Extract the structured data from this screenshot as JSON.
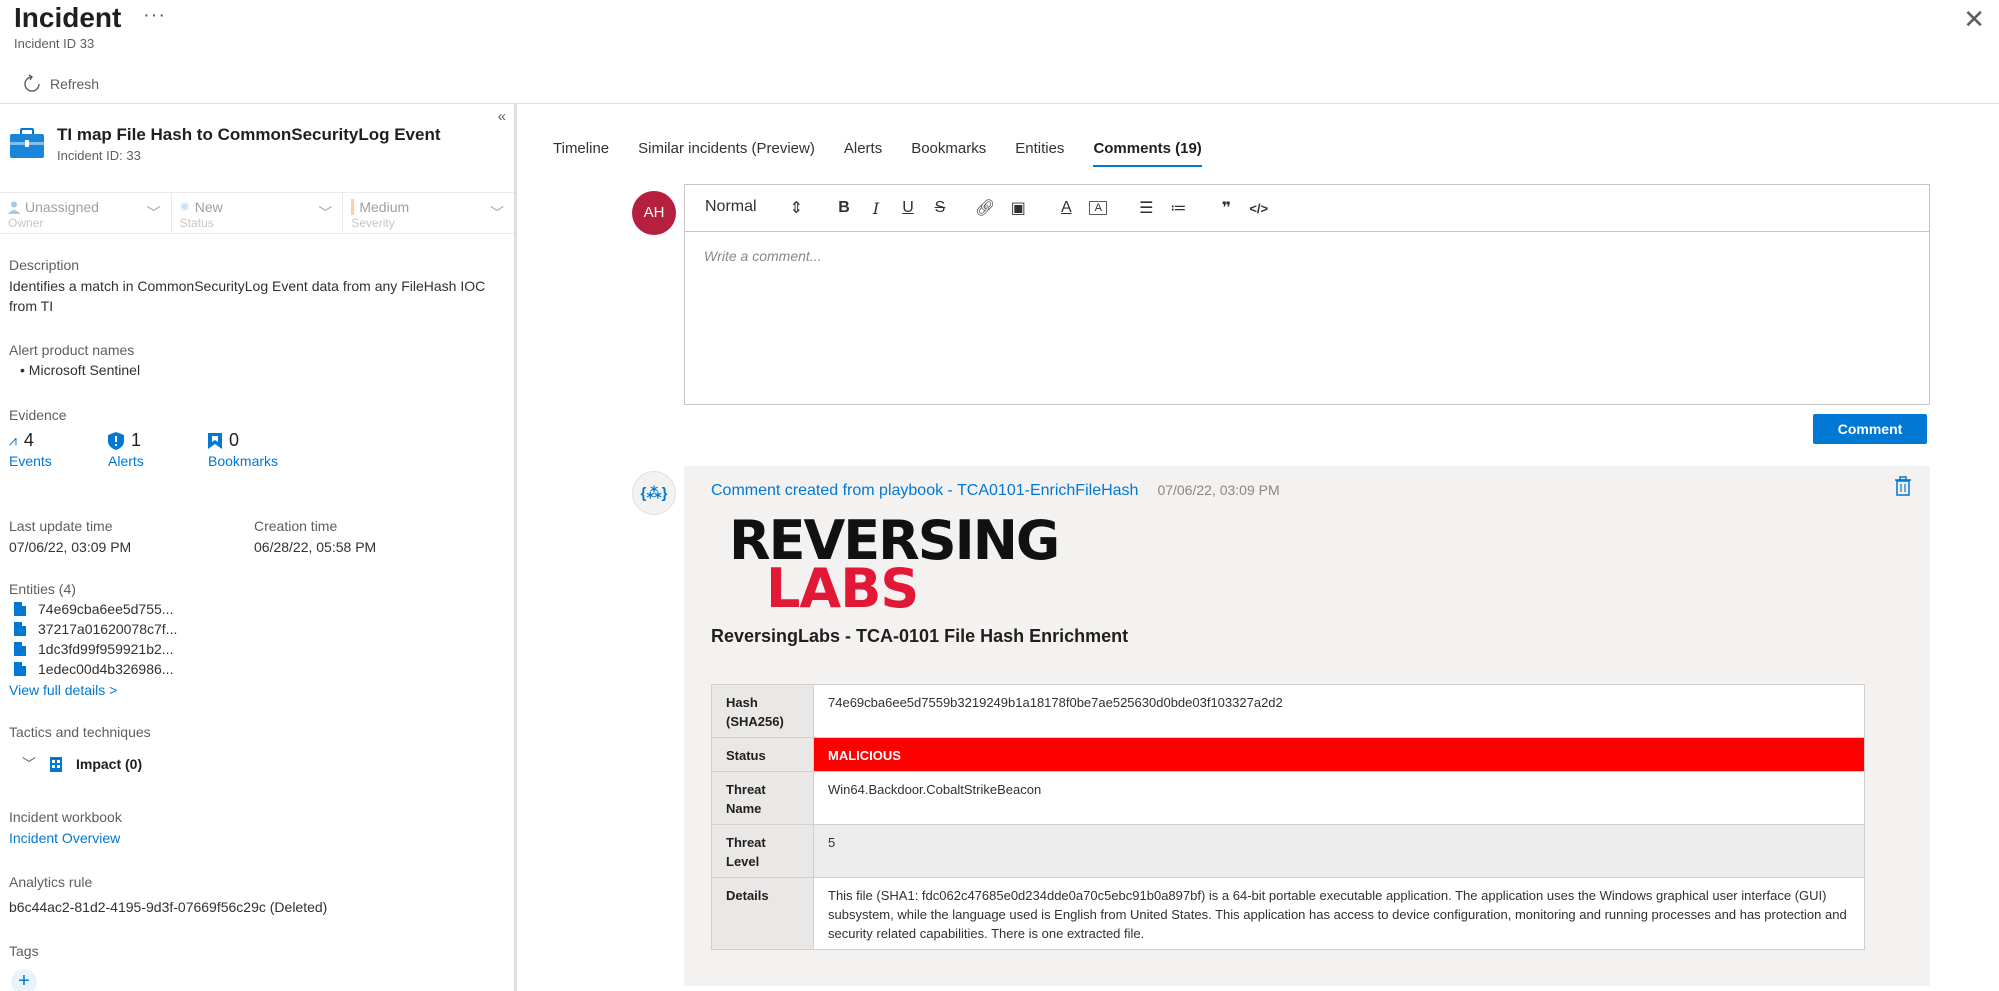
{
  "header": {
    "title": "Incident",
    "more": "···",
    "subtitle": "Incident ID 33",
    "refresh_label": "Refresh",
    "close": "✕"
  },
  "incident": {
    "name": "TI map File Hash to CommonSecurityLog Event",
    "id_label": "Incident ID: 33",
    "owner": {
      "value": "Unassigned",
      "label": "Owner"
    },
    "status": {
      "value": "New",
      "label": "Status"
    },
    "severity": {
      "value": "Medium",
      "label": "Severity"
    },
    "description_label": "Description",
    "description": "Identifies a match in CommonSecurityLog Event data from any FileHash IOC from TI",
    "alert_products_label": "Alert product names",
    "alert_products": [
      "Microsoft Sentinel"
    ],
    "evidence_label": "Evidence",
    "evidence": {
      "events": {
        "count": "4",
        "label": "Events"
      },
      "alerts": {
        "count": "1",
        "label": "Alerts"
      },
      "bookmarks": {
        "count": "0",
        "label": "Bookmarks"
      }
    },
    "last_update_label": "Last update time",
    "last_update": "07/06/22, 03:09 PM",
    "creation_label": "Creation time",
    "creation": "06/28/22, 05:58 PM",
    "entities_label": "Entities (4)",
    "entities": [
      "74e69cba6ee5d755...",
      "37217a01620078c7f...",
      "1dc3fd99f959921b2...",
      "1edec00d4b326986..."
    ],
    "view_full_details": "View full details >",
    "tactics_label": "Tactics and techniques",
    "tactic": "Impact (0)",
    "workbook_label": "Incident workbook",
    "workbook": "Incident Overview",
    "analytics_label": "Analytics rule",
    "analytics": "b6c44ac2-81d2-4195-9d3f-07669f56c29c (Deleted)",
    "tags_label": "Tags"
  },
  "tabs": [
    "Timeline",
    "Similar incidents (Preview)",
    "Alerts",
    "Bookmarks",
    "Entities",
    "Comments (19)"
  ],
  "editor": {
    "avatar": "AH",
    "format": "Normal",
    "placeholder": "Write a comment...",
    "submit_label": "Comment"
  },
  "comment": {
    "author": "Comment created from playbook - TCA0101-EnrichFileHash",
    "time": "07/06/22, 03:09 PM",
    "logo_line1": "REVERSING",
    "logo_line2": "LABS",
    "report_title": "ReversingLabs - TCA-0101 File Hash Enrichment",
    "rows": [
      {
        "key": "Hash (SHA256)",
        "value": "74e69cba6ee5d7559b3219249b1a18178f0be7ae525630d0bde03f103327a2d2"
      },
      {
        "key": "Status",
        "value": "MALICIOUS"
      },
      {
        "key": "Threat Name",
        "value": "Win64.Backdoor.CobaltStrikeBeacon"
      },
      {
        "key": "Threat Level",
        "value": "5"
      },
      {
        "key": "Details",
        "value": "This file (SHA1: fdc062c47685e0d234dde0a70c5ebc91b0a897bf) is a 64-bit portable executable application. The application uses the Windows graphical user interface (GUI) subsystem, while the language used is English from United States. This application has access to device configuration, monitoring and running processes and has protection and security related capabilities. There is one extracted file."
      }
    ]
  },
  "colors": {
    "accent": "#0078d4",
    "malicious": "#ff0000",
    "avatar": "#b4203e",
    "logo_red": "#e31837"
  }
}
